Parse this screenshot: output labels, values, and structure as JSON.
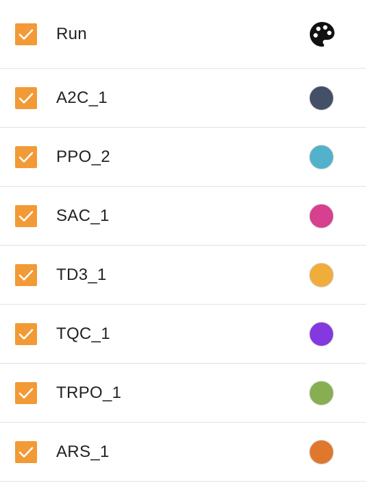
{
  "header": {
    "label": "Run",
    "checked": true,
    "icon": "palette-icon"
  },
  "runs": [
    {
      "label": "A2C_1",
      "checked": true,
      "color": "#435067"
    },
    {
      "label": "PPO_2",
      "checked": true,
      "color": "#52b1cb"
    },
    {
      "label": "SAC_1",
      "checked": true,
      "color": "#d73f8f"
    },
    {
      "label": "TD3_1",
      "checked": true,
      "color": "#f0ad3b"
    },
    {
      "label": "TQC_1",
      "checked": true,
      "color": "#8438e0"
    },
    {
      "label": "TRPO_1",
      "checked": true,
      "color": "#87af51"
    },
    {
      "label": "ARS_1",
      "checked": true,
      "color": "#df782d"
    }
  ],
  "colors": {
    "checkbox": "#f29a36",
    "checkmark": "#ffffff",
    "divider": "#e2e2e2"
  }
}
